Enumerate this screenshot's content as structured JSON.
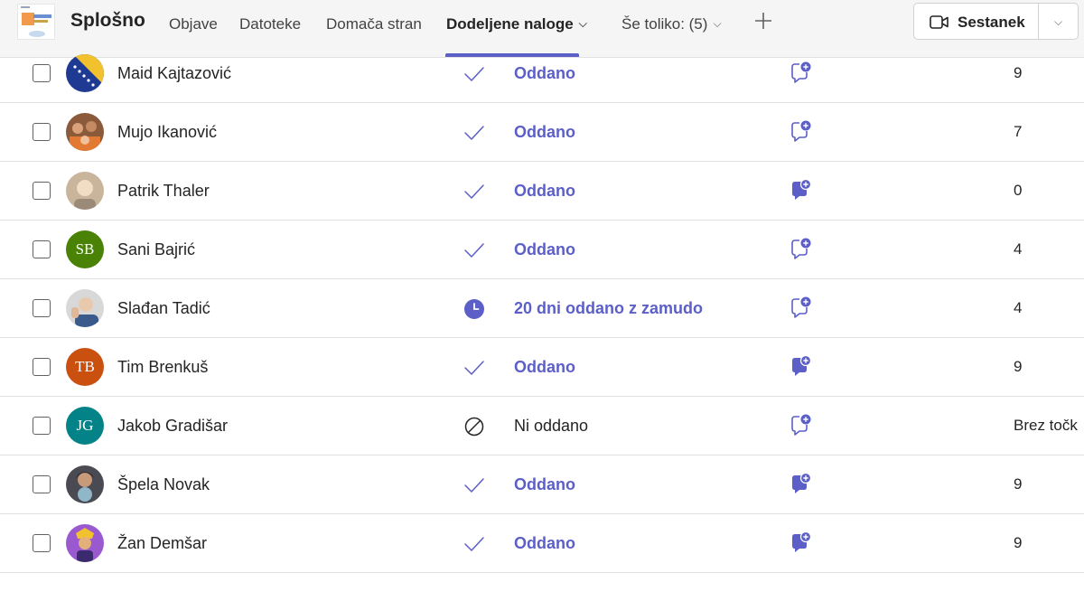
{
  "header": {
    "channel_title": "Splošno",
    "tabs": [
      {
        "label": "Objave"
      },
      {
        "label": "Datoteke"
      },
      {
        "label": "Domača stran"
      },
      {
        "label": "Dodeljene naloge"
      },
      {
        "label": "Še toliko: (5)"
      }
    ],
    "meet_label": "Sestanek"
  },
  "colors": {
    "accent": "#5b5fc7",
    "header_bg": "#f5f5f5",
    "divider": "#e0e0e0"
  },
  "students": [
    {
      "name": "Maid Kajtazović",
      "avatar": "photo-bosnia-flag",
      "status": "Oddano",
      "status_icon": "check-icon",
      "feedback_icon": "comment-add-outline-icon",
      "points": "9"
    },
    {
      "name": "Mujo Ikanović",
      "avatar": "photo-group",
      "status": "Oddano",
      "status_icon": "check-icon",
      "feedback_icon": "comment-add-outline-icon",
      "points": "7"
    },
    {
      "name": "Patrik Thaler",
      "avatar": "photo-person",
      "status": "Oddano",
      "status_icon": "check-icon",
      "feedback_icon": "comment-add-filled-icon",
      "points": "0"
    },
    {
      "name": "Sani Bajrić",
      "avatar_initials": "SB",
      "avatar_color": "#498205",
      "status": "Oddano",
      "status_icon": "check-icon",
      "feedback_icon": "comment-add-outline-icon",
      "points": "4"
    },
    {
      "name": "Slađan Tadić",
      "avatar": "photo-person-hand",
      "status": "20 dni oddano z zamudo",
      "status_icon": "clock-icon",
      "feedback_icon": "comment-add-outline-icon",
      "points": "4"
    },
    {
      "name": "Tim Brenkuš",
      "avatar_initials": "TB",
      "avatar_color": "#ca5010",
      "status": "Oddano",
      "status_icon": "check-icon",
      "feedback_icon": "comment-add-filled-icon",
      "points": "9"
    },
    {
      "name": "Jakob Gradišar",
      "avatar_initials": "JG",
      "avatar_color": "#038387",
      "status": "Ni oddano",
      "status_icon": "not-submitted-icon",
      "feedback_icon": "comment-add-outline-icon",
      "points": "Brez točk"
    },
    {
      "name": "Špela Novak",
      "avatar": "photo-person-dark",
      "status": "Oddano",
      "status_icon": "check-icon",
      "feedback_icon": "comment-add-filled-icon",
      "points": "9"
    },
    {
      "name": "Žan Demšar",
      "avatar": "photo-cartoon-purple",
      "status": "Oddano",
      "status_icon": "check-icon",
      "feedback_icon": "comment-add-filled-icon",
      "points": "9"
    }
  ]
}
